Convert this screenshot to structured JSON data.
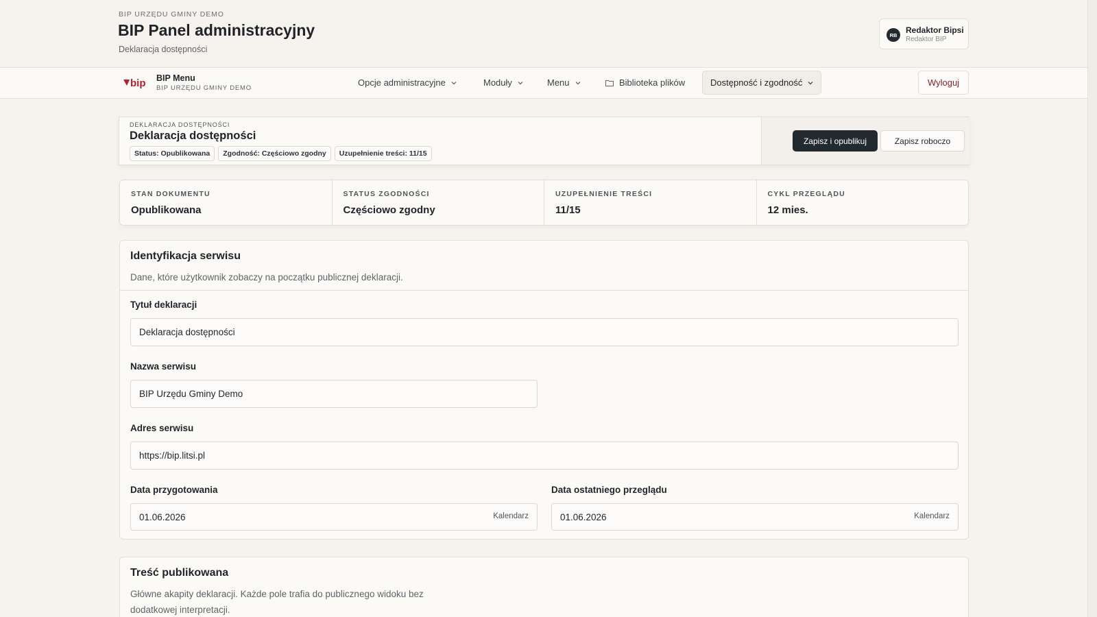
{
  "header": {
    "org_eyebrow": "BIP URZĘDU GMINY DEMO",
    "title": "BIP Panel administracyjny",
    "subtitle": "Deklaracja dostępności"
  },
  "user": {
    "initials": "RB",
    "name": "Redaktor Bipsi",
    "role": "Redaktor BIP"
  },
  "navbar": {
    "brand_logo_text": "bip",
    "brand_title": "BIP Menu",
    "brand_sub": "BIP URZĘDU GMINY DEMO",
    "items": [
      {
        "label": "Opcje administracyjne"
      },
      {
        "label": "Moduły"
      },
      {
        "label": "Menu"
      },
      {
        "label": "Biblioteka plików"
      },
      {
        "label": "Dostępność i zgodność"
      }
    ],
    "logout": "Wyloguj"
  },
  "document": {
    "eyebrow": "DEKLARACJA DOSTĘPNOŚCI",
    "title": "Deklaracja dostępności",
    "chips": [
      "Status: Opublikowana",
      "Zgodność: Częściowo zgodny",
      "Uzupełnienie treści: 11/15"
    ],
    "save_publish": "Zapisz i opublikuj",
    "save_draft": "Zapisz roboczo"
  },
  "stats": [
    {
      "label": "STAN DOKUMENTU",
      "value": "Opublikowana"
    },
    {
      "label": "STATUS ZGODNOŚCI",
      "value": "Częściowo zgodny"
    },
    {
      "label": "UZUPEŁNIENIE TREŚCI",
      "value": "11/15"
    },
    {
      "label": "CYKL PRZEGLĄDU",
      "value": "12 mies."
    }
  ],
  "identification": {
    "title": "Identyfikacja serwisu",
    "desc": "Dane, które użytkownik zobaczy na początku publicznej deklaracji.",
    "fields": {
      "decl_title": {
        "label": "Tytuł deklaracji",
        "value": "Deklaracja dostępności"
      },
      "service_name": {
        "label": "Nazwa serwisu",
        "value": "BIP Urzędu Gminy Demo"
      },
      "service_url": {
        "label": "Adres serwisu",
        "value": "https://bip.litsi.pl"
      },
      "prep_date": {
        "label": "Data przygotowania",
        "value": "01.06.2026",
        "calendar": "Kalendarz"
      },
      "review_date": {
        "label": "Data ostatniego przeglądu",
        "value": "01.06.2026",
        "calendar": "Kalendarz"
      }
    }
  },
  "published_content": {
    "title": "Treść publikowana",
    "desc_line1": "Główne akapity deklaracji. Każde pole trafia do publicznego widoku bez",
    "desc_line2": "dodatkowej interpretacji."
  }
}
